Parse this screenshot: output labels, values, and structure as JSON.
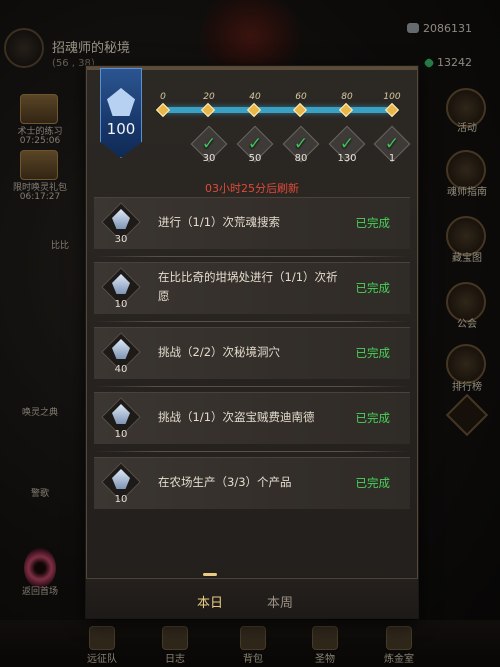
{
  "hud": {
    "location_title": "招魂师的秘境",
    "coords": "(56 , 38)",
    "resource_1": "2086131",
    "resource_2": "13242"
  },
  "left_col": {
    "item_1_name": "术士的练习",
    "item_1_time": "07:25:06",
    "item_2_name": "限时唤灵礼包",
    "item_2_time": "06:17:27",
    "side_label": "比比",
    "summon_label": "唤灵之典",
    "event_label": "警歌",
    "return_label": "返回首场"
  },
  "right_col": [
    {
      "label": "活动"
    },
    {
      "label": "魂师指南"
    },
    {
      "label": "藏宝图"
    },
    {
      "label": "公会"
    },
    {
      "label": "排行榜"
    }
  ],
  "bottom_nav": [
    {
      "label": "远征队"
    },
    {
      "label": "日志"
    },
    {
      "label": "背包"
    },
    {
      "label": "圣物"
    },
    {
      "label": "炼金室"
    }
  ],
  "progress": {
    "current_points": 100,
    "ticks": [
      "0",
      "20",
      "40",
      "60",
      "80",
      "100"
    ],
    "rewards": [
      {
        "qty": "30",
        "claimed": true
      },
      {
        "qty": "50",
        "claimed": true
      },
      {
        "qty": "80",
        "claimed": true
      },
      {
        "qty": "130",
        "claimed": true
      },
      {
        "qty": "1",
        "claimed": true
      }
    ],
    "refresh_note": "03小时25分后刷新"
  },
  "quests": [
    {
      "text": "进行（1/1）次荒魂搜索",
      "reward": "30",
      "status": "已完成"
    },
    {
      "text": "在比比奇的坩埚处进行（1/1）次祈愿",
      "reward": "10",
      "status": "已完成"
    },
    {
      "text": "挑战（2/2）次秘境洞穴",
      "reward": "40",
      "status": "已完成"
    },
    {
      "text": "挑战（1/1）次盗宝贼费迪南德",
      "reward": "10",
      "status": "已完成"
    },
    {
      "text": "在农场生产（3/3）个产品",
      "reward": "10",
      "status": "已完成"
    }
  ],
  "tabs": {
    "daily": "本日",
    "weekly": "本周"
  },
  "colors": {
    "accent_gold": "#e9cb86",
    "complete_green": "#49d25a",
    "refresh_red": "#e04a3a",
    "track_blue": "#3aa0c4"
  }
}
